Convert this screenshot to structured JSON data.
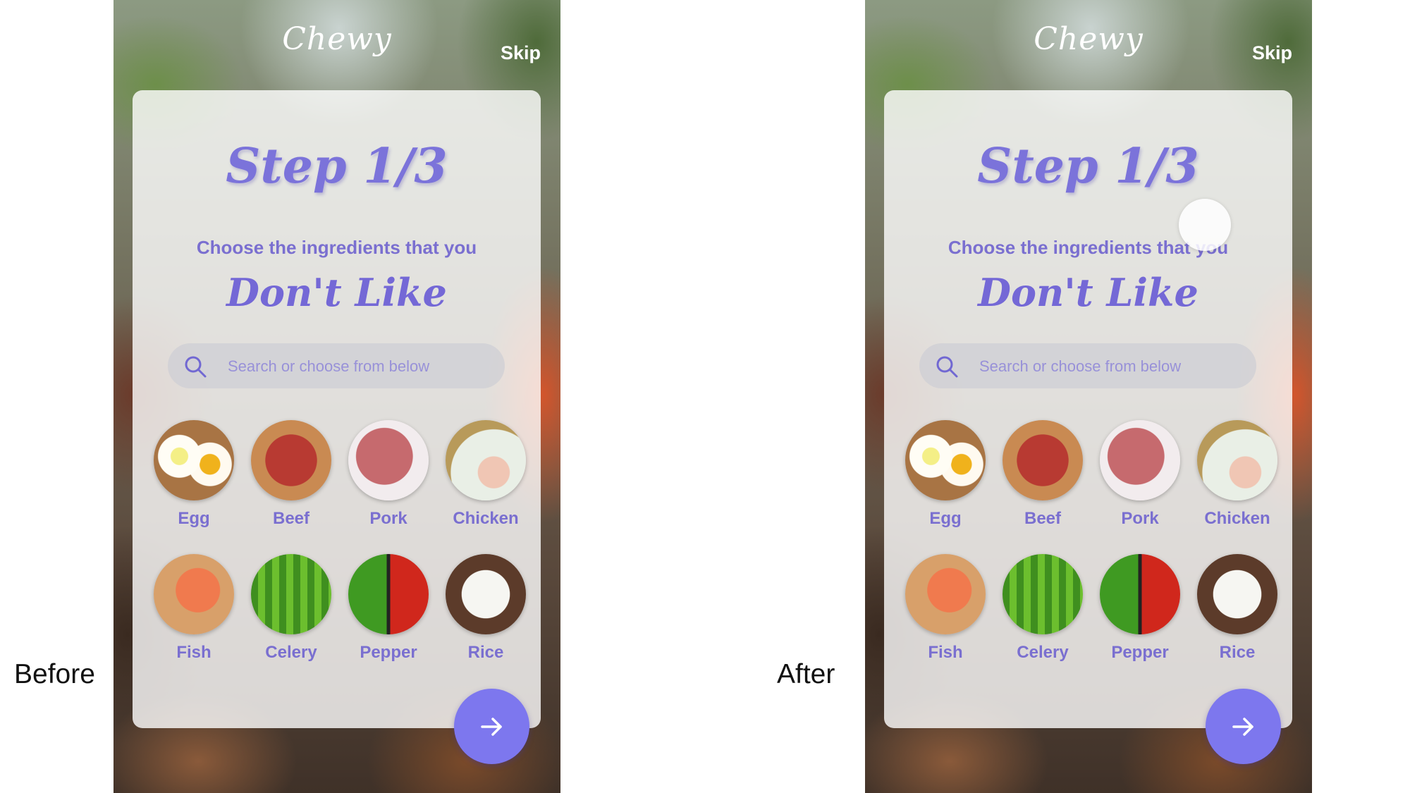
{
  "labels": {
    "before": "Before",
    "after": "After"
  },
  "app": {
    "logo": "Chewy",
    "skip_label": "Skip",
    "step_title": "Step 1/3",
    "subtitle": "Choose the ingredients that you",
    "emphasis": "Don't Like",
    "search_placeholder": "Search or choose from below",
    "ingredients": [
      {
        "label": "Egg",
        "icon": "egg-icon"
      },
      {
        "label": "Beef",
        "icon": "beef-icon"
      },
      {
        "label": "Pork",
        "icon": "pork-icon"
      },
      {
        "label": "Chicken",
        "icon": "chicken-icon"
      },
      {
        "label": "Fish",
        "icon": "fish-icon"
      },
      {
        "label": "Celery",
        "icon": "celery-icon"
      },
      {
        "label": "Pepper",
        "icon": "pepper-icon"
      },
      {
        "label": "Rice",
        "icon": "rice-icon"
      }
    ],
    "next_icon": "arrow-right-icon"
  },
  "colors": {
    "accent": "#7d77ee",
    "text_purple": "#7a6fd0"
  }
}
